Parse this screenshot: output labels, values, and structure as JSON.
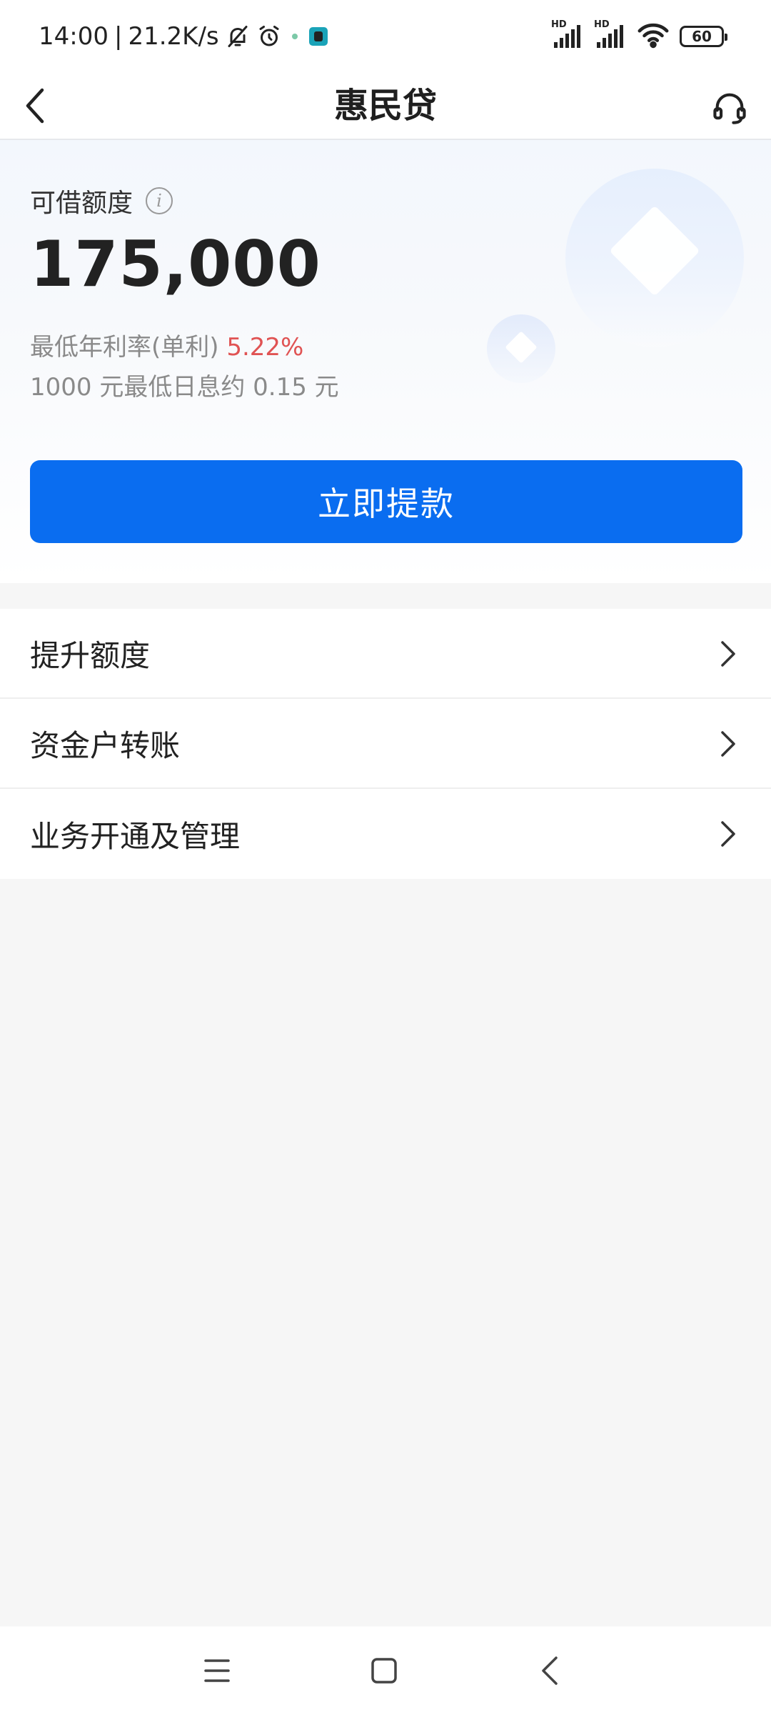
{
  "status_bar": {
    "time": "14:00",
    "separator": "|",
    "net_speed": "21.2K/s",
    "battery": "60",
    "signal_label_1": "HD",
    "signal_label_2": "HD"
  },
  "nav": {
    "title": "惠民贷"
  },
  "credit": {
    "label": "可借额度",
    "amount": "175,000",
    "rate_prefix": "最低年利率(单利)",
    "rate_value": "5.22%",
    "interest_note": "1000 元最低日息约 0.15 元",
    "withdraw_label": "立即提款"
  },
  "menu": {
    "items": [
      {
        "label": "提升额度"
      },
      {
        "label": "资金户转账"
      },
      {
        "label": "业务开通及管理"
      }
    ]
  },
  "colors": {
    "primary": "#0a6df0",
    "rate_highlight": "#e05353",
    "page_bg": "#f6f6f6"
  }
}
